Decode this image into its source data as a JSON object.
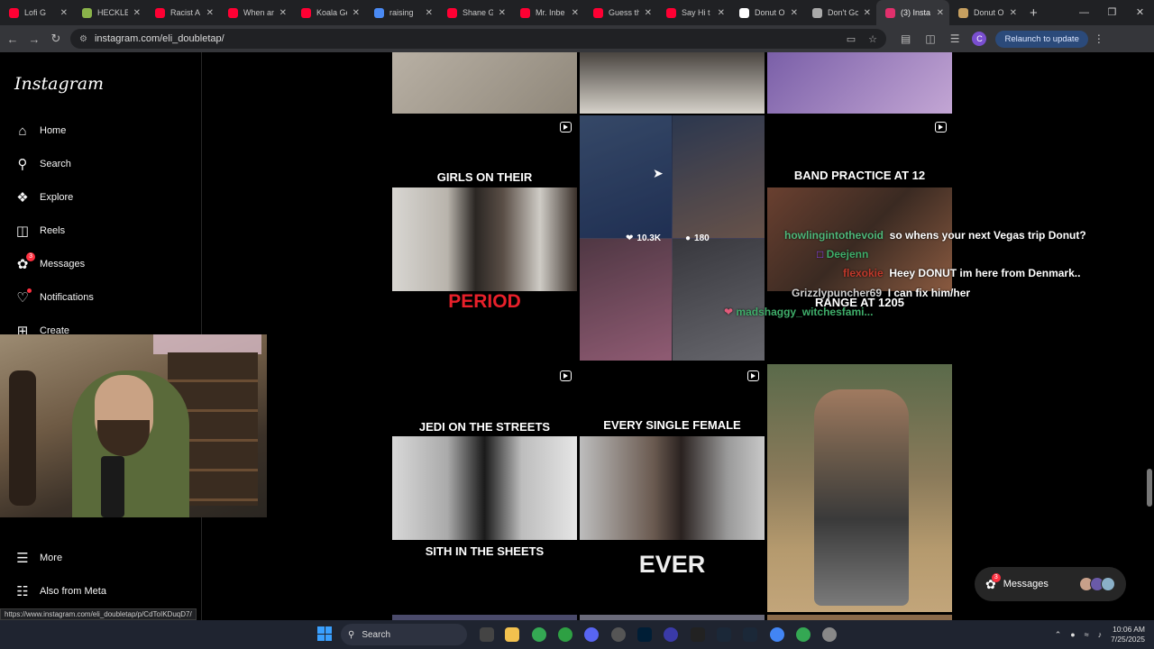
{
  "browser": {
    "tabs": [
      {
        "title": "Lofi G",
        "color": "#ff0033"
      },
      {
        "title": "HECKLE",
        "color": "#8ab34a"
      },
      {
        "title": "Racist A",
        "color": "#ff0033"
      },
      {
        "title": "When an",
        "color": "#ff0033"
      },
      {
        "title": "Koala Ge",
        "color": "#ff0033"
      },
      {
        "title": "raising",
        "color": "#4a8af4"
      },
      {
        "title": "Shane G",
        "color": "#ff0033"
      },
      {
        "title": "Mr. Inbe",
        "color": "#ff0033"
      },
      {
        "title": "Guess th",
        "color": "#ff0033"
      },
      {
        "title": "Say Hi t",
        "color": "#ff0033"
      },
      {
        "title": "Donut O",
        "color": "#ffffff"
      },
      {
        "title": "Don't Go",
        "color": "#aaaaaa"
      },
      {
        "title": "(3) Insta",
        "color": "#e1306c"
      },
      {
        "title": "Donut O",
        "color": "#c7a060"
      }
    ],
    "active_tab_index": 12,
    "url": "instagram.com/eli_doubletap/",
    "relaunch_label": "Relaunch to update",
    "profile_initial": "C",
    "status_url": "https://www.instagram.com/eli_doubletap/p/CdToIKDuqD7/"
  },
  "sidebar": {
    "logo": "Instagram",
    "items": [
      {
        "label": "Home",
        "icon": "home-icon"
      },
      {
        "label": "Search",
        "icon": "search-icon"
      },
      {
        "label": "Explore",
        "icon": "compass-icon"
      },
      {
        "label": "Reels",
        "icon": "reels-icon"
      },
      {
        "label": "Messages",
        "icon": "messenger-icon",
        "badge": "3"
      },
      {
        "label": "Notifications",
        "icon": "heart-icon"
      },
      {
        "label": "Create",
        "icon": "plus-icon"
      }
    ],
    "more": "More",
    "meta": "Also from Meta"
  },
  "grid": {
    "captions": {
      "girls_top": "GIRLS ON THEIR",
      "girls_bottom": "PERIOD",
      "band_top": "BAND PRACTICE AT 12",
      "band_bottom": "RANGE AT 1205",
      "jedi_top": "JEDI ON THE STREETS",
      "jedi_bottom": "SITH IN THE SHEETS",
      "female_top": "EVERY SINGLE FEMALE",
      "female_bottom": "EVER"
    },
    "hover_likes": "10.3K",
    "hover_comments": "180"
  },
  "chat": [
    {
      "user": "howlingintothevoid",
      "msg": "so whens your next Vegas trip Donut?",
      "color": "#4fb87a"
    },
    {
      "user": "Deejenn",
      "msg": "",
      "color": "#3fae6a"
    },
    {
      "user": "flexokie",
      "msg": "Heey DONUT im here from Denmark..",
      "color": "#c0392b"
    },
    {
      "user": "Grizzlypuncher69",
      "msg": "I can fix him/her",
      "color": "#d0d0d0"
    },
    {
      "user": "madshaggy_witchesfami...",
      "msg": "",
      "color": "#3fae6a"
    }
  ],
  "messages_pill": {
    "label": "Messages",
    "badge": "3"
  },
  "taskbar": {
    "search_placeholder": "Search",
    "time": "10:06 AM",
    "date": "7/25/2025"
  }
}
